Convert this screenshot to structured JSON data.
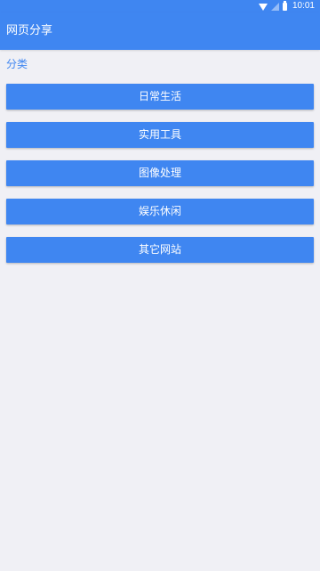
{
  "status_bar": {
    "time": "10:01",
    "icons": [
      "wifi-icon",
      "signal-icon",
      "battery-icon"
    ]
  },
  "app_bar": {
    "title": "网页分享"
  },
  "section": {
    "title": "分类"
  },
  "categories": [
    {
      "label": "日常生活"
    },
    {
      "label": "实用工具"
    },
    {
      "label": "图像处理"
    },
    {
      "label": "娱乐休闲"
    },
    {
      "label": "其它网站"
    }
  ],
  "colors": {
    "primary": "#3f86f1",
    "background": "#f0f0f5",
    "button_text": "#ffffff"
  }
}
